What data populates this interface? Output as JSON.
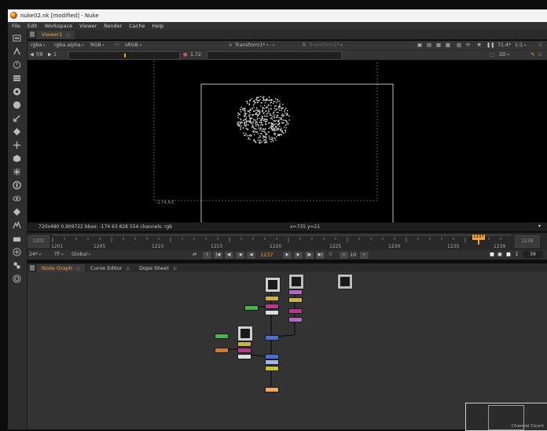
{
  "window": {
    "title": "nuke02.nk [modified] - Nuke"
  },
  "menu": [
    "File",
    "Edit",
    "Workspace",
    "Viewer",
    "Render",
    "Cache",
    "Help"
  ],
  "viewer_tab": {
    "label": "Viewer1"
  },
  "viewer_controls": {
    "channels": "rgba",
    "alpha_channel": "rgba.alpha",
    "display": "RGB",
    "ip": "IP",
    "colorspace": "sRGB",
    "a_label": "A",
    "a_input": "Transform1*",
    "a_op": "-",
    "b_label": "B",
    "b_input": "Transform1*",
    "zoom": "71.4*",
    "ratio": "1:1",
    "fstop": "f/8",
    "frame_step": "1",
    "gamma": "1.72",
    "view_mode": "2D"
  },
  "viewer_overlay": {
    "coord": "-174,63"
  },
  "viewer_info": {
    "left": "720x480 0.909722  bbox: -174 63 828 554 channels: rgb",
    "center": "x=735 y=21"
  },
  "timeline": {
    "start": "1201",
    "end": "1239",
    "labels": [
      "1201",
      "1205",
      "1210",
      "1215",
      "1220",
      "1225",
      "1230",
      "1235",
      "1239"
    ],
    "current_marker": "1237",
    "fps": "24*",
    "tf": "TF",
    "scope": "Global",
    "current_frame": "1237",
    "increment": "10",
    "end_frame": "39"
  },
  "node_graph_tabs": [
    "Node Graph",
    "Curve Editor",
    "Dope Sheet"
  ],
  "minimap": {
    "label": "Channel Count"
  },
  "colors": {
    "accent": "#f2a33a",
    "viewer_bg": "#000000",
    "graph_bg": "#333333"
  }
}
